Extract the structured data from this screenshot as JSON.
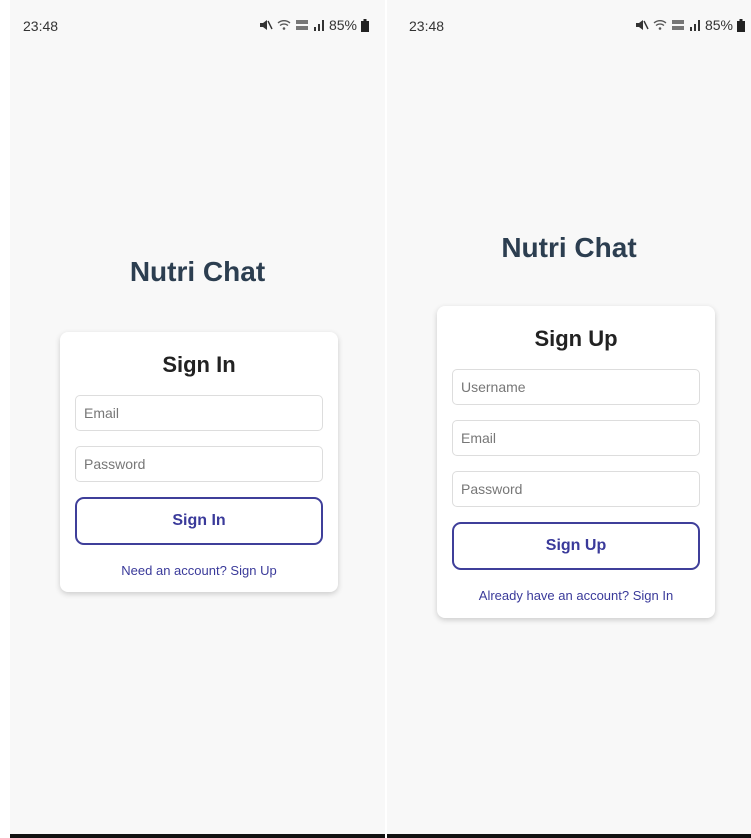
{
  "screens": [
    {
      "status_bar": {
        "time": "23:48",
        "battery": "85%"
      },
      "app_title": "Nutri Chat",
      "form": {
        "title": "Sign In",
        "fields": [
          {
            "placeholder": "Email"
          },
          {
            "placeholder": "Password"
          }
        ],
        "submit_label": "Sign In",
        "switch_link": "Need an account? Sign Up"
      }
    },
    {
      "status_bar": {
        "time": "23:48",
        "battery": "85%"
      },
      "app_title": "Nutri Chat",
      "form": {
        "title": "Sign Up",
        "fields": [
          {
            "placeholder": "Username"
          },
          {
            "placeholder": "Email"
          },
          {
            "placeholder": "Password"
          }
        ],
        "submit_label": "Sign Up",
        "switch_link": "Already have an account? Sign In"
      }
    }
  ],
  "colors": {
    "title": "#2c3e50",
    "accent": "#3f3f9a",
    "background": "#f8f8f8"
  },
  "icons": [
    "mute-icon",
    "wifi-icon",
    "volte-icon",
    "signal-icon",
    "battery-icon"
  ]
}
